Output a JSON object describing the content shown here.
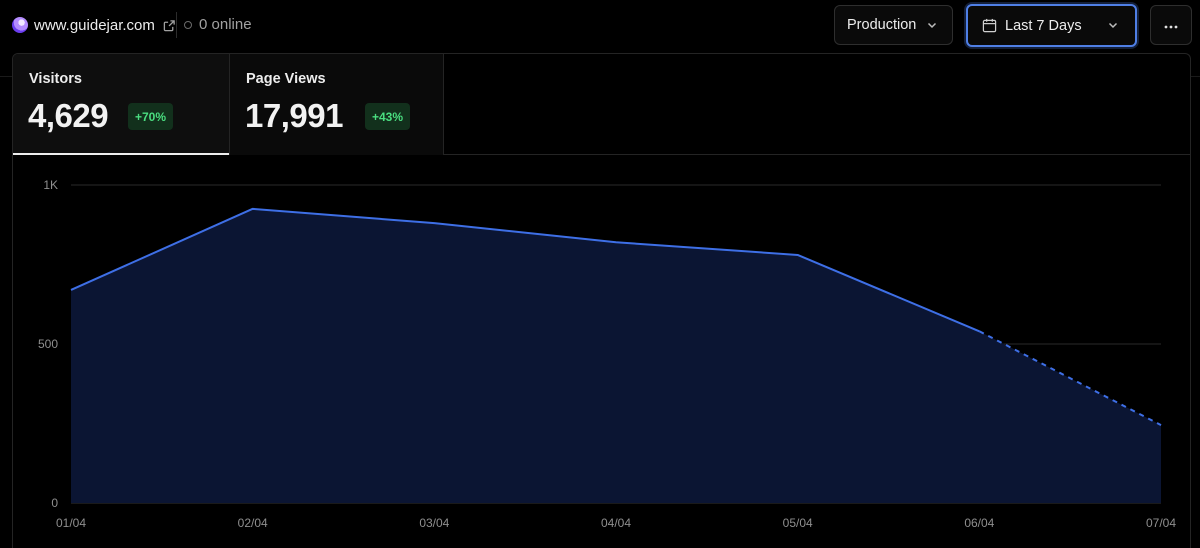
{
  "topbar": {
    "site_name": "www.guidejar.com",
    "online_text": "0 online",
    "environment": "Production",
    "date_range": "Last 7 Days"
  },
  "icons": {
    "favicon": "site-favicon",
    "external": "external-link-icon",
    "calendar": "calendar-icon",
    "chevron": "chevron-down-icon",
    "more": "more-horizontal-icon"
  },
  "tabs": [
    {
      "label": "Visitors",
      "value": "4,629",
      "change": "+70%"
    },
    {
      "label": "Page Views",
      "value": "17,991",
      "change": "+43%"
    }
  ],
  "colors": {
    "accent": "#4f7fe6",
    "line": "#3e6fe6",
    "area": "#0b1533",
    "positive": "#4ade80"
  },
  "chart_data": {
    "type": "area",
    "categories": [
      "01/04",
      "02/04",
      "03/04",
      "04/04",
      "05/04",
      "06/04",
      "07/04"
    ],
    "series": [
      {
        "values": [
          670,
          925,
          880,
          820,
          780,
          540,
          245
        ]
      }
    ],
    "dashed_from_index": 5,
    "ylim": [
      0,
      1000
    ],
    "yticks": [
      {
        "value": 0,
        "label": "0"
      },
      {
        "value": 500,
        "label": "500"
      },
      {
        "value": 1000,
        "label": "1K"
      }
    ],
    "grid": true
  }
}
